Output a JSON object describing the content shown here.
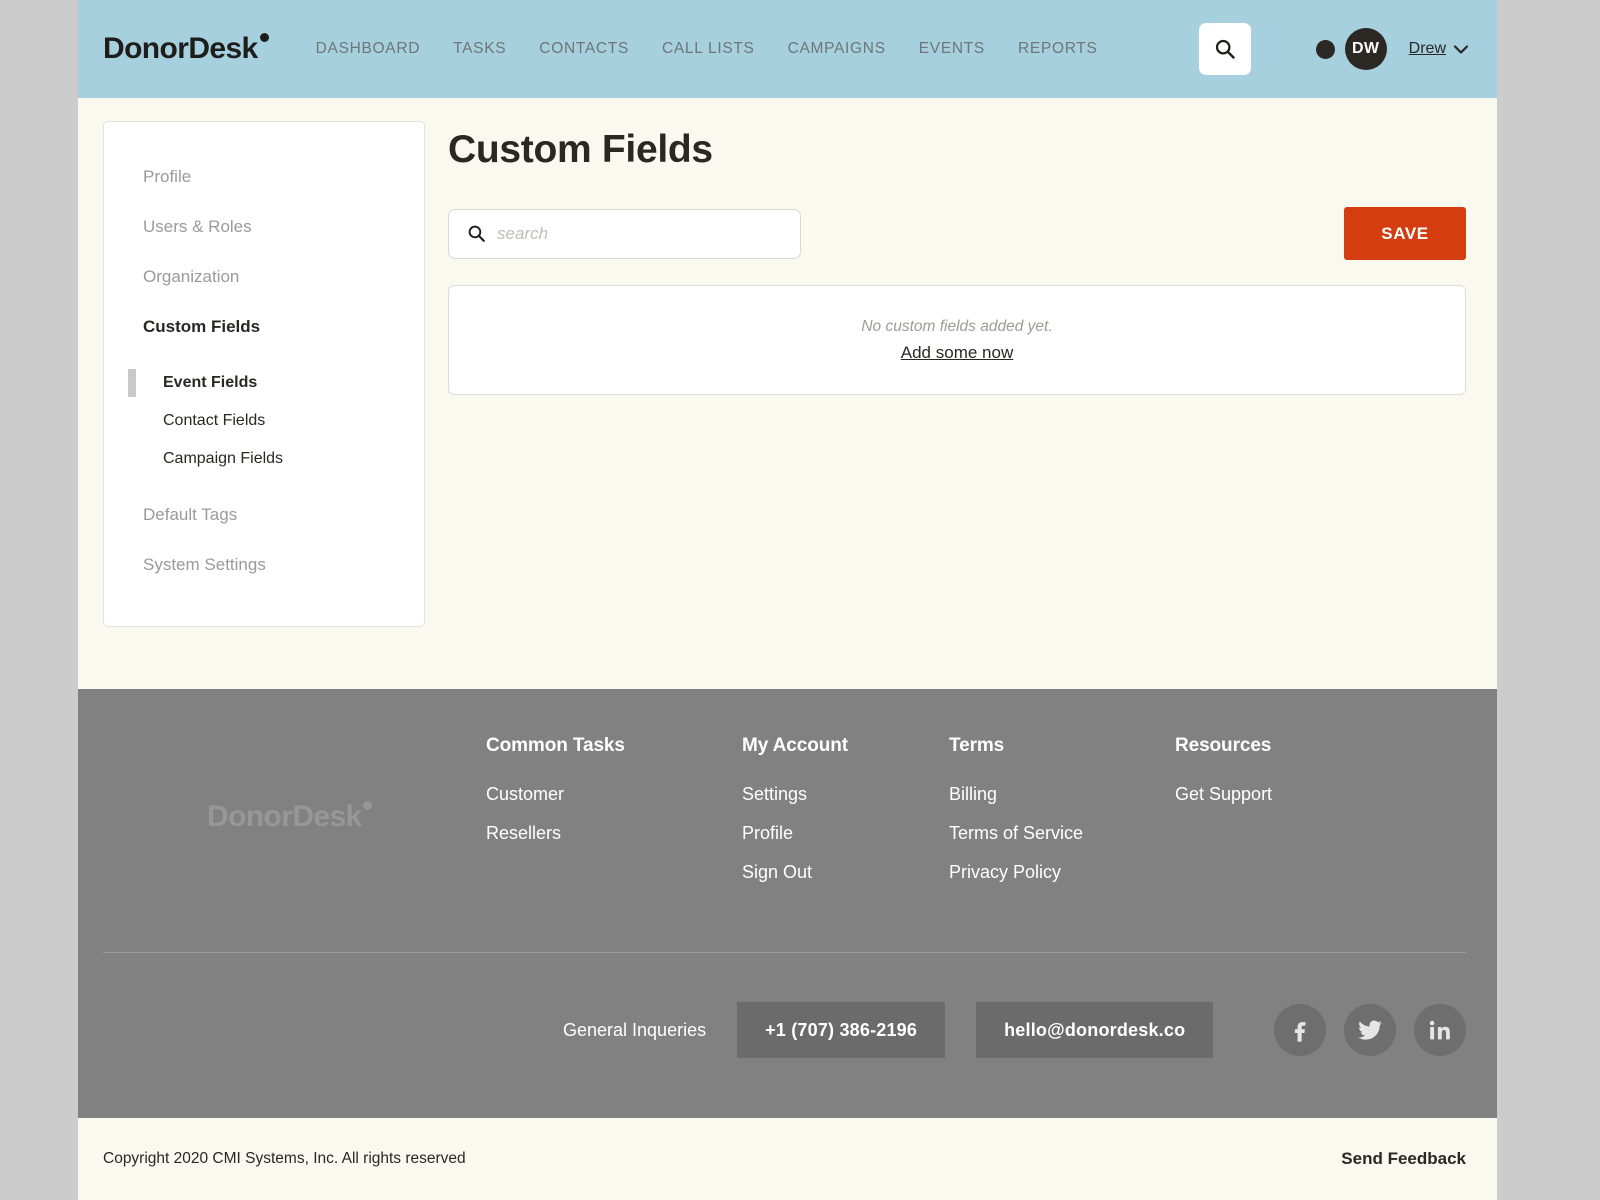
{
  "header": {
    "logo": "DonorDesk",
    "nav": [
      {
        "label": "DASHBOARD"
      },
      {
        "label": "TASKS"
      },
      {
        "label": "CONTACTS"
      },
      {
        "label": "CALL LISTS"
      },
      {
        "label": "CAMPAIGNS"
      },
      {
        "label": "EVENTS"
      },
      {
        "label": "REPORTS"
      }
    ],
    "search_icon": "search-icon",
    "avatar_initials": "DW",
    "user_name": "Drew",
    "brand_bg": "#a6d0de",
    "nav_color": "#6f7579"
  },
  "sidebar": {
    "items": [
      {
        "label": "Profile",
        "active": false
      },
      {
        "label": "Users & Roles",
        "active": false
      },
      {
        "label": "Organization",
        "active": false
      },
      {
        "label": "Custom Fields",
        "active": true
      }
    ],
    "sub_items": [
      {
        "label": "Event Fields",
        "current": true
      },
      {
        "label": "Contact Fields",
        "current": false
      },
      {
        "label": "Campaign Fields",
        "current": false
      }
    ],
    "items_after": [
      {
        "label": "Default Tags",
        "active": false
      },
      {
        "label": "System Settings",
        "active": false
      }
    ]
  },
  "main": {
    "title": "Custom Fields",
    "search": {
      "value": "",
      "placeholder": "search"
    },
    "save_label": "SAVE",
    "save_color": "#d43d0f",
    "empty_state": {
      "message": "No custom fields added yet.",
      "link": "Add some now"
    }
  },
  "footer": {
    "logo": "DonorDesk",
    "columns": [
      {
        "heading": "Common Tasks",
        "links": [
          {
            "label": "Customer"
          },
          {
            "label": "Resellers"
          }
        ]
      },
      {
        "heading": "My Account",
        "links": [
          {
            "label": "Settings"
          },
          {
            "label": "Profile"
          },
          {
            "label": "Sign Out"
          }
        ]
      },
      {
        "heading": "Terms",
        "links": [
          {
            "label": "Billing"
          },
          {
            "label": "Terms of Service"
          },
          {
            "label": "Privacy Policy"
          }
        ]
      },
      {
        "heading": "Resources",
        "links": [
          {
            "label": "Get Support"
          }
        ]
      }
    ],
    "general_inquiries_label": "General Inqueries",
    "phone": "+1 (707) 386-2196",
    "email": "hello@donordesk.co",
    "socials": [
      {
        "name": "facebook-icon"
      },
      {
        "name": "twitter-icon"
      },
      {
        "name": "linkedin-icon"
      }
    ]
  },
  "copyright": {
    "text": "Copyright 2020 CMI Systems, Inc. All rights reserved",
    "feedback": "Send Feedback"
  }
}
